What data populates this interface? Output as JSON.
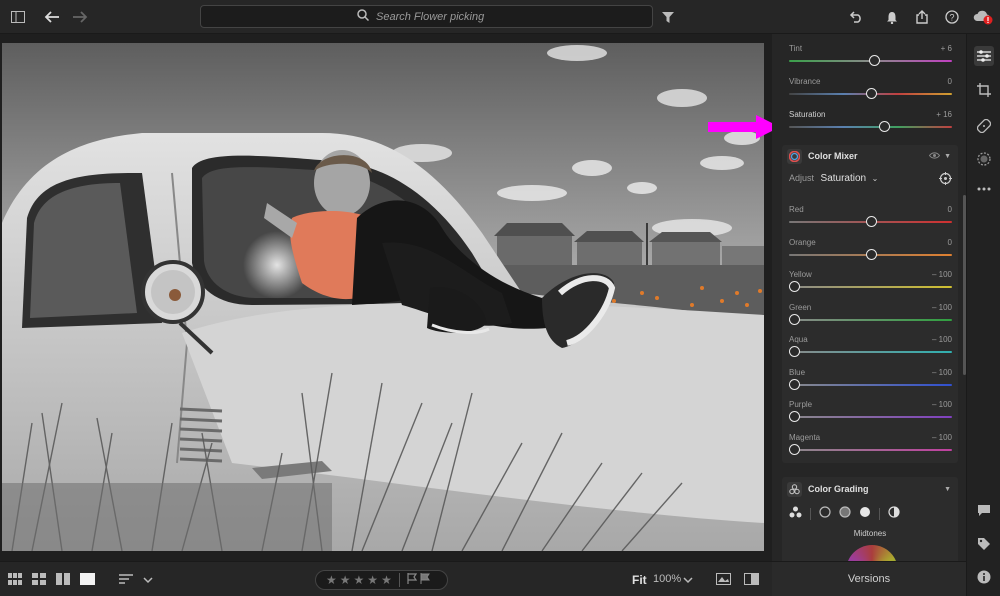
{
  "search": {
    "placeholder": "Search Flower picking"
  },
  "panel": {
    "top_sliders": [
      {
        "label": "Tint",
        "value": "+ 6",
        "pos": 0.52
      },
      {
        "label": "Vibrance",
        "value": "0",
        "pos": 0.5
      },
      {
        "label": "Saturation",
        "value": "+ 16",
        "pos": 0.58
      }
    ],
    "color_mixer": {
      "title": "Color Mixer",
      "adjust_label": "Adjust",
      "adjust_value": "Saturation",
      "sliders": [
        {
          "label": "Red",
          "value": "0",
          "pos": 0.5
        },
        {
          "label": "Orange",
          "value": "0",
          "pos": 0.5
        },
        {
          "label": "Yellow",
          "value": "– 100",
          "pos": 0.0
        },
        {
          "label": "Green",
          "value": "– 100",
          "pos": 0.0
        },
        {
          "label": "Aqua",
          "value": "– 100",
          "pos": 0.0
        },
        {
          "label": "Blue",
          "value": "– 100",
          "pos": 0.0
        },
        {
          "label": "Purple",
          "value": "– 100",
          "pos": 0.0
        },
        {
          "label": "Magenta",
          "value": "– 100",
          "pos": 0.0
        }
      ]
    },
    "color_grading": {
      "title": "Color Grading",
      "mode_label": "Midtones"
    },
    "versions_label": "Versions"
  },
  "bottom": {
    "fit_label": "Fit",
    "zoom_label": "100%"
  },
  "colors": {
    "accent_arrow": "#ff00ff",
    "panel_bg": "#262626",
    "notification": "#e02020"
  }
}
